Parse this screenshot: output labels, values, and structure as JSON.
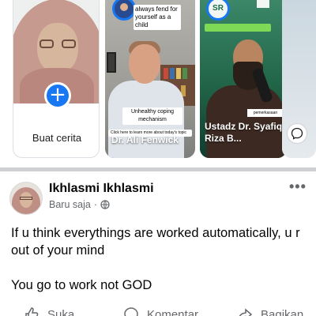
{
  "stories": {
    "create": {
      "label": "Buat cerita"
    },
    "items": [
      {
        "top_caption": "always fend for yourself as a child",
        "mid_caption": "Unhealthy coping mechanism",
        "link_text": "Click here to learn more about today's topic",
        "name": "Dr. Ali Fenwick"
      },
      {
        "logo_text": "SR",
        "badge_text": "pemerkasaan",
        "name": "Ustadz Dr. Syafiq Riza B..."
      }
    ]
  },
  "post": {
    "author": "Ikhlasmi Ikhlasmi",
    "time": "Baru saja",
    "separator": "·",
    "text": "If u think everythings are worked automatically, u r out of your mind\n\nYou go to work not GOD",
    "actions": {
      "like": "Suka",
      "comment": "Komentar",
      "share": "Bagikan"
    }
  },
  "colors": {
    "accent": "#1877f2",
    "divider": "#ced0d4",
    "secondary_text": "#65676b"
  }
}
